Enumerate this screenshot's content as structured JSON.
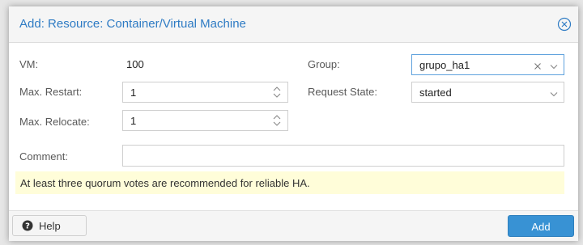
{
  "dialog": {
    "title": "Add: Resource: Container/Virtual Machine"
  },
  "form": {
    "vm": {
      "label": "VM:",
      "value": "100"
    },
    "max_restart": {
      "label": "Max. Restart:",
      "value": "1"
    },
    "max_relocate": {
      "label": "Max. Relocate:",
      "value": "1"
    },
    "group": {
      "label": "Group:",
      "value": "grupo_ha1"
    },
    "request_state": {
      "label": "Request State:",
      "value": "started"
    },
    "comment": {
      "label": "Comment:",
      "value": ""
    }
  },
  "warning": {
    "text": "At least three quorum votes are recommended for reliable HA."
  },
  "footer": {
    "help_label": "Help",
    "add_label": "Add"
  },
  "icons": {
    "close": "close-circle-icon",
    "help": "question-circle-icon",
    "spinner": "spinner-arrows-icon",
    "clear": "clear-x-icon",
    "dropdown": "chevron-down-icon"
  },
  "colors": {
    "title": "#2e7bc4",
    "primary_button": "#3892d4",
    "warning_bg": "#fffdd9",
    "focus_border": "#5fa2dd"
  }
}
